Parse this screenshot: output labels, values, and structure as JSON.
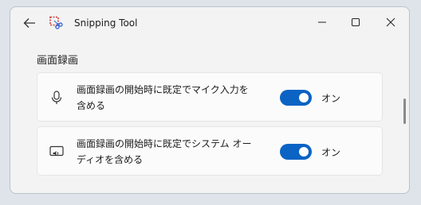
{
  "window": {
    "title": "Snipping Tool",
    "controls": [
      "minimize",
      "maximize",
      "close"
    ]
  },
  "section": {
    "title": "画面録画"
  },
  "settings": [
    {
      "icon": "microphone-icon",
      "label": "画面録画の開始時に既定でマイク入力を含める",
      "label_line1": "画面録画の開始時に既定でマイク入力を",
      "label_line2": "含める",
      "toggle_on": true,
      "toggle_label": "オン"
    },
    {
      "icon": "system-audio-icon",
      "label": "画面録画の開始時に既定でシステム オーディオを含める",
      "label_line1": "画面録画の開始時に既定でシステム オー",
      "label_line2": "ディオを含める",
      "toggle_on": true,
      "toggle_label": "オン"
    }
  ],
  "colors": {
    "accent": "#0b63c4",
    "background": "#f3f3f3",
    "card": "#fbfbfb"
  }
}
